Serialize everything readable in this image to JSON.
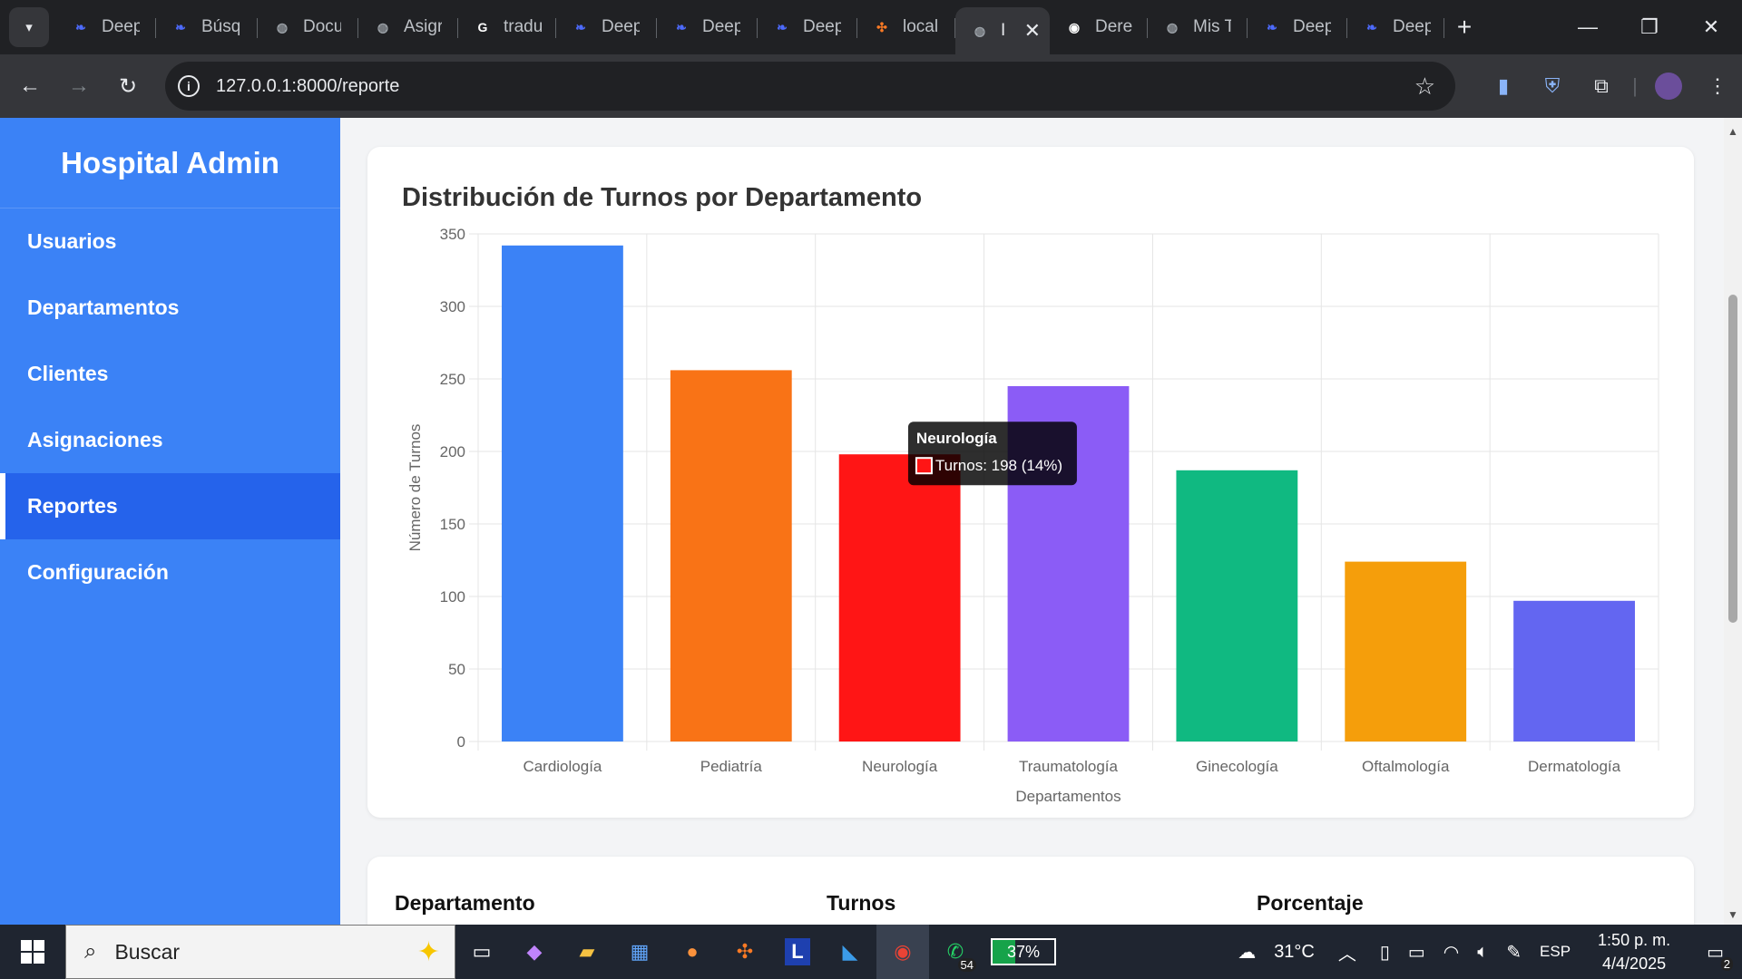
{
  "browser": {
    "tabs": [
      {
        "label": "Deep",
        "icon": "deepseek-whale-icon",
        "color": "#4d6bfe"
      },
      {
        "label": "Búsq",
        "icon": "deepseek-whale-icon",
        "color": "#4d6bfe"
      },
      {
        "label": "Docu",
        "icon": "globe-icon",
        "color": "#9aa0a6"
      },
      {
        "label": "Asigr",
        "icon": "globe-icon",
        "color": "#9aa0a6"
      },
      {
        "label": "tradu",
        "icon": "google-icon",
        "color": "#ffffff"
      },
      {
        "label": "Deep",
        "icon": "deepseek-whale-icon",
        "color": "#4d6bfe"
      },
      {
        "label": "Deep",
        "icon": "deepseek-whale-icon",
        "color": "#4d6bfe"
      },
      {
        "label": "Deep",
        "icon": "deepseek-whale-icon",
        "color": "#4d6bfe"
      },
      {
        "label": "local",
        "icon": "xampp-icon",
        "color": "#fb7a24"
      },
      {
        "label": "I",
        "icon": "globe-icon",
        "color": "#9aa0a6",
        "active": true
      },
      {
        "label": "Dere",
        "icon": "github-icon",
        "color": "#ffffff"
      },
      {
        "label": "Mis T",
        "icon": "globe-icon",
        "color": "#9aa0a6"
      },
      {
        "label": "Deep",
        "icon": "deepseek-whale-icon",
        "color": "#4d6bfe"
      },
      {
        "label": "Deep",
        "icon": "deepseek-whale-icon",
        "color": "#4d6bfe"
      }
    ],
    "url": "127.0.0.1:8000/reporte"
  },
  "sidebar": {
    "brand": "Hospital Admin",
    "items": [
      {
        "label": "Usuarios"
      },
      {
        "label": "Departamentos"
      },
      {
        "label": "Clientes"
      },
      {
        "label": "Asignaciones"
      },
      {
        "label": "Reportes",
        "active": true
      },
      {
        "label": "Configuración"
      }
    ],
    "bg_color": "#3b82f6",
    "active_color": "#2563eb"
  },
  "report": {
    "title": "Distribución de Turnos por Departamento",
    "table_headers": [
      "Departamento",
      "Turnos",
      "Porcentaje"
    ]
  },
  "chart_data": {
    "type": "bar",
    "title": "Distribución de Turnos por Departamento",
    "xlabel": "Departamentos",
    "ylabel": "Número de Turnos",
    "categories": [
      "Cardiología",
      "Pediatría",
      "Neurología",
      "Traumatología",
      "Ginecología",
      "Oftalmología",
      "Dermatología"
    ],
    "values": [
      342,
      256,
      198,
      245,
      187,
      124,
      97
    ],
    "colors": [
      "#3b82f6",
      "#f97316",
      "#ff1515",
      "#8b5cf6",
      "#10b981",
      "#f59e0b",
      "#6366f1"
    ],
    "ylim": [
      0,
      350
    ],
    "yticks": [
      0,
      50,
      100,
      150,
      200,
      250,
      300,
      350
    ],
    "grid": true,
    "tooltip": {
      "title": "Neurología",
      "text": "Turnos: 198 (14%)",
      "color": "#ff1515"
    }
  },
  "taskbar": {
    "search_placeholder": "Buscar",
    "battery": "37%",
    "battery_level": 0.37,
    "temperature": "31°C",
    "language": "ESP",
    "time": "1:50 p. m.",
    "date": "4/4/2025",
    "whatsapp_badge": "54",
    "notifications": "2"
  }
}
